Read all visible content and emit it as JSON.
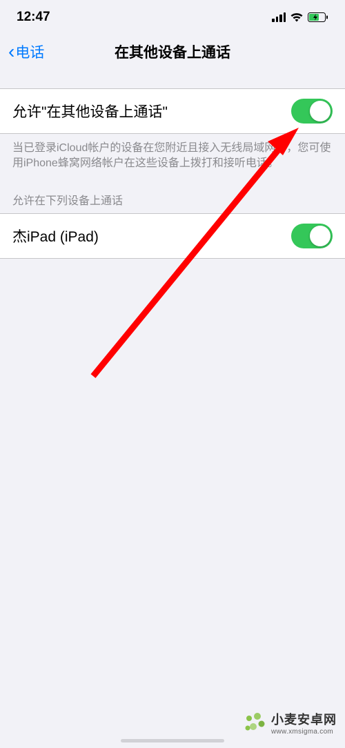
{
  "status": {
    "time": "12:47"
  },
  "nav": {
    "back_label": "电话",
    "title": "在其他设备上通话"
  },
  "main_row": {
    "label": "允许\"在其他设备上通话\"",
    "enabled": true
  },
  "footer_text": "当已登录iCloud帐户的设备在您附近且接入无线局域网时，您可使用iPhone蜂窝网络帐户在这些设备上拨打和接听电话。",
  "devices_section": {
    "header": "允许在下列设备上通话",
    "items": [
      {
        "label": "杰iPad (iPad)",
        "enabled": true
      }
    ]
  },
  "watermark": {
    "brand": "小麦安卓网",
    "url": "www.xmsigma.com"
  }
}
